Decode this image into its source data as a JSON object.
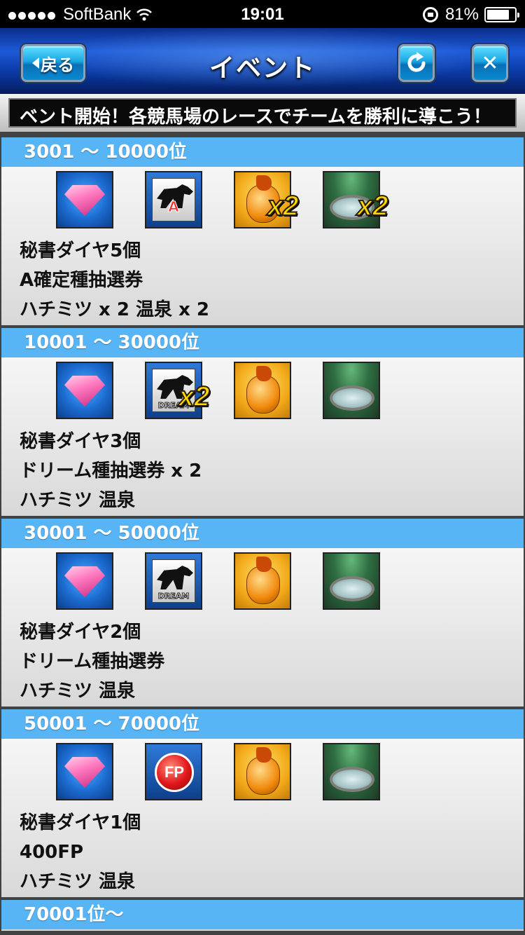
{
  "status": {
    "carrier": "SoftBank",
    "time": "19:01",
    "battery": "81%",
    "battery_level": 0.81
  },
  "header": {
    "back_label": "戻る",
    "title": "イベント",
    "reload_icon": "reload-icon",
    "close_icon": "close-icon",
    "close_glyph": "✕"
  },
  "ticker": {
    "text": "ベント開始！各競馬場のレースでチームを勝利に導こう！"
  },
  "ranks": [
    {
      "range": "3001 〜 10000位",
      "icons": [
        "diamond",
        "ticket-a",
        "honey",
        "onsen"
      ],
      "multipliers": {
        "honey": "x2",
        "onsen": "x2"
      },
      "ticket_label": "A",
      "rewards": [
        "秘書ダイヤ5個",
        "A確定種抽選券",
        "ハチミツ x 2 温泉 x 2"
      ]
    },
    {
      "range": "10001 〜 30000位",
      "icons": [
        "diamond",
        "ticket-dream",
        "honey",
        "onsen"
      ],
      "multipliers": {
        "ticket": "x2"
      },
      "ticket_label": "DREAM",
      "rewards": [
        "秘書ダイヤ3個",
        "ドリーム種抽選券 x 2",
        "ハチミツ 温泉"
      ]
    },
    {
      "range": "30001 〜 50000位",
      "icons": [
        "diamond",
        "ticket-dream",
        "honey",
        "onsen"
      ],
      "ticket_label": "DREAM",
      "rewards": [
        "秘書ダイヤ2個",
        "ドリーム種抽選券",
        "ハチミツ 温泉"
      ]
    },
    {
      "range": "50001 〜 70000位",
      "icons": [
        "diamond",
        "fp-coin",
        "honey",
        "onsen"
      ],
      "fp_label": "FP",
      "rewards": [
        "秘書ダイヤ1個",
        "400FP",
        "ハチミツ 温泉"
      ]
    },
    {
      "range": "70001位〜"
    }
  ]
}
